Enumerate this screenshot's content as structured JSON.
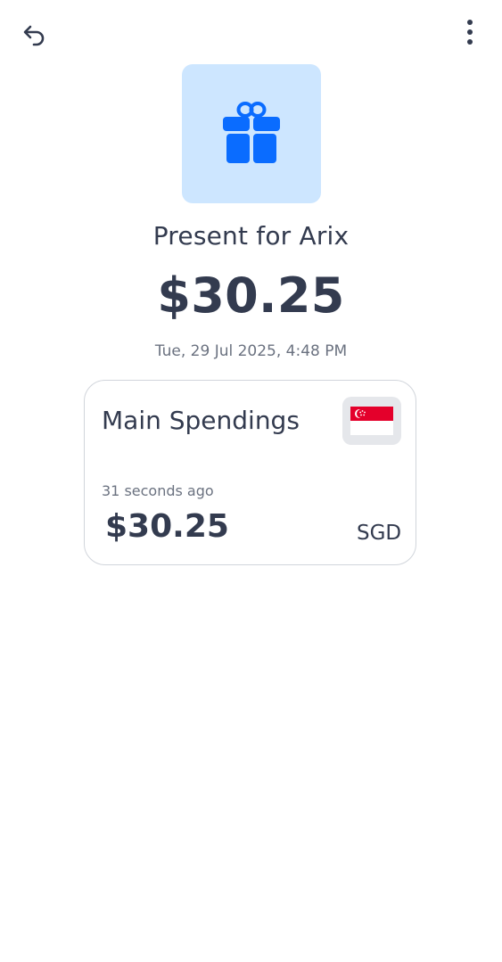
{
  "header": {
    "back_icon": "undo-arrow-icon",
    "menu_icon": "more-vertical-icon"
  },
  "transaction": {
    "icon": "gift-icon",
    "title": "Present for Arix",
    "amount": "$30.25",
    "datetime": "Tue, 29 Jul 2025, 4:48 PM"
  },
  "account": {
    "name": "Main Spendings",
    "flag_icon": "singapore-flag-icon",
    "updated": "31 seconds ago",
    "balance": "$30.25",
    "currency": "SGD"
  },
  "colors": {
    "accent": "#0a6cff",
    "tile_bg": "#cde6ff",
    "text": "#333b4f",
    "muted": "#6b7280",
    "flag_red": "#e4002b"
  }
}
